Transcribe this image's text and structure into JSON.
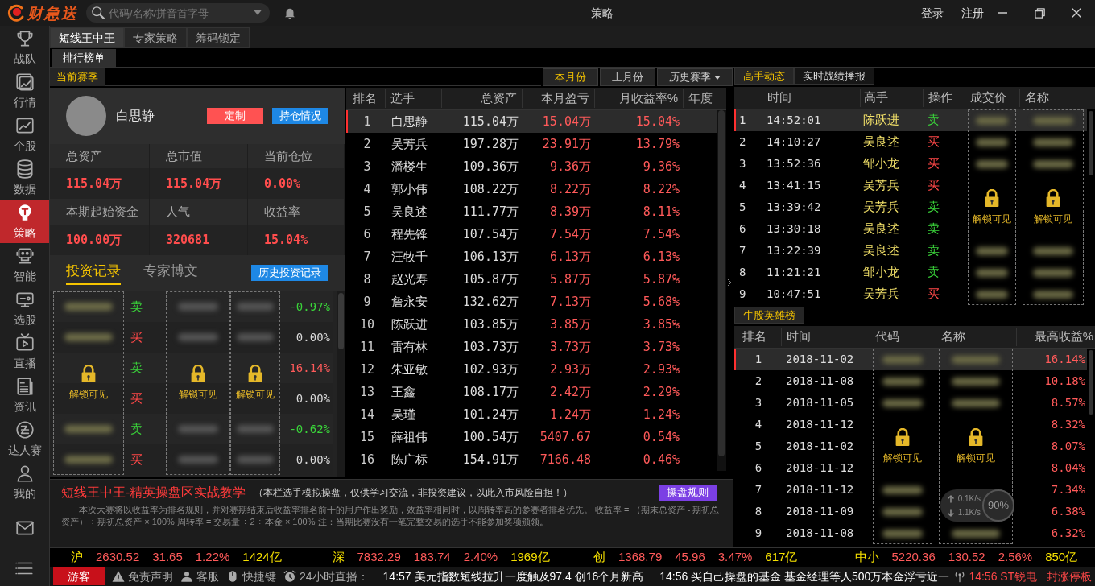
{
  "app": {
    "logo": "财急送"
  },
  "search": {
    "placeholder": "代码/名称/拼音首字母"
  },
  "window": {
    "title": "策略"
  },
  "account_links": [
    "登录",
    "注册"
  ],
  "sidebar": {
    "items": [
      {
        "label": "战队",
        "selected": false
      },
      {
        "label": "行情",
        "selected": false
      },
      {
        "label": "个股",
        "selected": false
      },
      {
        "label": "数据",
        "selected": false
      },
      {
        "label": "策略",
        "selected": true
      },
      {
        "label": "智能",
        "selected": false
      },
      {
        "label": "选股",
        "selected": false
      },
      {
        "label": "直播",
        "selected": false
      },
      {
        "label": "资讯",
        "selected": false
      },
      {
        "label": "达人赛",
        "selected": false
      },
      {
        "label": "我的",
        "selected": false
      }
    ]
  },
  "tabs": [
    {
      "label": "短线王中王",
      "selected": true
    },
    {
      "label": "专家策略",
      "selected": false
    },
    {
      "label": "筹码锁定",
      "selected": false
    }
  ],
  "subtabs": [
    {
      "label": "排行榜单",
      "selected": true
    }
  ],
  "season": {
    "label": "当前赛季",
    "periods": [
      {
        "label": "本月份",
        "selected": true,
        "has_menu": false
      },
      {
        "label": "上月份",
        "selected": false,
        "has_menu": false
      },
      {
        "label": "历史赛季",
        "selected": false,
        "has_menu": true
      }
    ]
  },
  "profile": {
    "name": "白思静",
    "buttons": [
      {
        "label": "定制",
        "kind": "custom"
      },
      {
        "label": "持仓情况",
        "kind": "holdings"
      }
    ],
    "stats": [
      {
        "label": "总资产",
        "value": "115.04万"
      },
      {
        "label": "总市值",
        "value": "115.04万"
      },
      {
        "label": "当前仓位",
        "value": "0.00%"
      },
      {
        "label": "本期起始资金",
        "value": "100.00万"
      },
      {
        "label": "人气",
        "value": "320681"
      },
      {
        "label": "收益率",
        "value": "15.04%"
      }
    ]
  },
  "records": {
    "tabs": [
      {
        "label": "投资记录",
        "selected": true
      },
      {
        "label": "专家博文",
        "selected": false
      }
    ],
    "history_button": "历史投资记录",
    "rows": [
      {
        "action": "卖",
        "kind": "sell",
        "return": "-0.97%",
        "color": "#3ad43a"
      },
      {
        "action": "买",
        "kind": "buy",
        "return": "0.00%",
        "color": "#d8d8d8"
      },
      {
        "action": "卖",
        "kind": "sell",
        "return": "16.14%",
        "color": "#ff5a5a"
      },
      {
        "action": "买",
        "kind": "buy",
        "return": "0.00%",
        "color": "#d8d8d8"
      },
      {
        "action": "卖",
        "kind": "sell",
        "return": "-0.62%",
        "color": "#3ad43a"
      },
      {
        "action": "买",
        "kind": "buy",
        "return": "0.00%",
        "color": "#d8d8d8"
      }
    ],
    "locks": [
      "解锁可见",
      "解锁可见",
      "解锁可见"
    ]
  },
  "ranking": {
    "columns": [
      "排名",
      "选手",
      "总资产",
      "本月盈亏",
      "月收益率%",
      "年度"
    ],
    "rows": [
      {
        "rank": "1",
        "name": "白思静",
        "assets": "115.04万",
        "pnl": "15.04万",
        "rate": "15.04%",
        "selected": true
      },
      {
        "rank": "2",
        "name": "吴芳兵",
        "assets": "197.28万",
        "pnl": "23.91万",
        "rate": "13.79%",
        "selected": false
      },
      {
        "rank": "3",
        "name": "潘楼生",
        "assets": "109.36万",
        "pnl": "9.36万",
        "rate": "9.36%",
        "selected": false
      },
      {
        "rank": "4",
        "name": "郭小伟",
        "assets": "108.22万",
        "pnl": "8.22万",
        "rate": "8.22%",
        "selected": false
      },
      {
        "rank": "5",
        "name": "吴良述",
        "assets": "111.77万",
        "pnl": "8.39万",
        "rate": "8.11%",
        "selected": false
      },
      {
        "rank": "6",
        "name": "程先锋",
        "assets": "107.54万",
        "pnl": "7.54万",
        "rate": "7.54%",
        "selected": false
      },
      {
        "rank": "7",
        "name": "汪牧千",
        "assets": "106.13万",
        "pnl": "6.13万",
        "rate": "6.13%",
        "selected": false
      },
      {
        "rank": "8",
        "name": "赵光寿",
        "assets": "105.87万",
        "pnl": "5.87万",
        "rate": "5.87%",
        "selected": false
      },
      {
        "rank": "9",
        "name": "詹永安",
        "assets": "132.62万",
        "pnl": "7.13万",
        "rate": "5.68%",
        "selected": false
      },
      {
        "rank": "10",
        "name": "陈跃进",
        "assets": "103.85万",
        "pnl": "3.85万",
        "rate": "3.85%",
        "selected": false
      },
      {
        "rank": "11",
        "name": "雷有林",
        "assets": "103.73万",
        "pnl": "3.73万",
        "rate": "3.73%",
        "selected": false
      },
      {
        "rank": "12",
        "name": "朱亚敏",
        "assets": "102.93万",
        "pnl": "2.93万",
        "rate": "2.93%",
        "selected": false
      },
      {
        "rank": "13",
        "name": "王鑫",
        "assets": "108.17万",
        "pnl": "2.42万",
        "rate": "2.29%",
        "selected": false
      },
      {
        "rank": "14",
        "name": "吴瑾",
        "assets": "101.24万",
        "pnl": "1.24万",
        "rate": "1.24%",
        "selected": false
      },
      {
        "rank": "15",
        "name": "薛祖伟",
        "assets": "100.54万",
        "pnl": "5407.67",
        "rate": "0.54%",
        "selected": false
      },
      {
        "rank": "16",
        "name": "陈广标",
        "assets": "154.91万",
        "pnl": "7166.48",
        "rate": "0.46%",
        "selected": false
      }
    ]
  },
  "notice": {
    "title": "短线王中王-精英操盘区实战教学",
    "note": "（本栏选手模拟操盘，仅供学习交流，非投资建议，以此入市风险自担！）",
    "button": "操盘规则",
    "body": "本次大赛将以收益率为排名规则，并对赛期结束后收益率排名前十的用户作出奖励，效益率相同时，以周转率高的参赛者排名优先。 收益率 = （期末总资产 - 期初总资产） ÷ 期初总资产 × 100% 周转率 = 交易量 ÷ 2 ÷ 本金 × 100% 注：当期比赛没有一笔完整交易的选手不能参加奖项颁领。"
  },
  "right_tabs": [
    {
      "label": "高手动态",
      "selected": true
    },
    {
      "label": "实时战绩播报",
      "selected": false
    }
  ],
  "trades": {
    "columns": [
      "时间",
      "高手",
      "操作",
      "成交价",
      "名称"
    ],
    "rows": [
      {
        "index": "1",
        "time": "14:52:01",
        "trader": "陈跃进",
        "action": "卖",
        "kind": "sell",
        "selected": true
      },
      {
        "index": "2",
        "time": "14:10:27",
        "trader": "吴良述",
        "action": "买",
        "kind": "buy",
        "selected": false
      },
      {
        "index": "3",
        "time": "13:52:36",
        "trader": "邹小龙",
        "action": "买",
        "kind": "buy",
        "selected": false
      },
      {
        "index": "4",
        "time": "13:41:15",
        "trader": "吴芳兵",
        "action": "买",
        "kind": "buy",
        "selected": false
      },
      {
        "index": "5",
        "time": "13:39:42",
        "trader": "吴芳兵",
        "action": "卖",
        "kind": "sell",
        "selected": false
      },
      {
        "index": "6",
        "time": "13:30:18",
        "trader": "吴良述",
        "action": "卖",
        "kind": "sell",
        "selected": false
      },
      {
        "index": "7",
        "time": "13:22:39",
        "trader": "吴良述",
        "action": "卖",
        "kind": "sell",
        "selected": false
      },
      {
        "index": "8",
        "time": "11:21:21",
        "trader": "邹小龙",
        "action": "卖",
        "kind": "sell",
        "selected": false
      },
      {
        "index": "9",
        "time": "10:47:51",
        "trader": "吴芳兵",
        "action": "买",
        "kind": "buy",
        "selected": false
      }
    ],
    "locks": [
      "解锁可见",
      "解锁可见"
    ]
  },
  "heroes": {
    "tab": "牛股英雄榜",
    "columns": [
      "排名",
      "时间",
      "代码",
      "名称",
      "最高收益%"
    ],
    "rows": [
      {
        "rank": "1",
        "date": "2018-11-02",
        "return": "16.14%",
        "selected": true
      },
      {
        "rank": "2",
        "date": "2018-11-08",
        "return": "10.18%",
        "selected": false
      },
      {
        "rank": "3",
        "date": "2018-11-05",
        "return": "8.57%",
        "selected": false
      },
      {
        "rank": "4",
        "date": "2018-11-12",
        "return": "8.32%",
        "selected": false
      },
      {
        "rank": "5",
        "date": "2018-11-02",
        "return": "8.07%",
        "selected": false
      },
      {
        "rank": "6",
        "date": "2018-11-12",
        "return": "8.04%",
        "selected": false
      },
      {
        "rank": "7",
        "date": "2018-11-12",
        "return": "7.34%",
        "selected": false
      },
      {
        "rank": "8",
        "date": "2018-11-09",
        "return": "6.38%",
        "selected": false
      },
      {
        "rank": "9",
        "date": "2018-11-08",
        "return": "6.32%",
        "selected": false
      }
    ],
    "locks": [
      "解锁可见",
      "解锁可见"
    ]
  },
  "net_widget": {
    "upload": "0.1K/s",
    "download": "1.1K/s",
    "percent": "90%"
  },
  "ticker": [
    {
      "name": "沪",
      "price": "2630.52",
      "change": "31.65",
      "pct": "1.22%",
      "volume": "1424亿"
    },
    {
      "name": "深",
      "price": "7832.29",
      "change": "183.74",
      "pct": "2.40%",
      "volume": "1969亿"
    },
    {
      "name": "创",
      "price": "1368.79",
      "change": "45.96",
      "pct": "3.47%",
      "volume": "617亿"
    },
    {
      "name": "中小",
      "price": "5220.36",
      "change": "130.52",
      "pct": "2.56%",
      "volume": "850亿"
    }
  ],
  "status_bar": {
    "user": "游客",
    "links": [
      "免责声明",
      "客服",
      "快捷键",
      "24小时直播："
    ],
    "news": [
      "14:57 美元指数短线拉升一度触及97.4 创16个月新高",
      "14:56 买自己操盘的基金 基金经理等人500万本金浮亏近一"
    ],
    "alert": {
      "text": "14:56 ST锐电",
      "tag": "封涨停板"
    }
  }
}
